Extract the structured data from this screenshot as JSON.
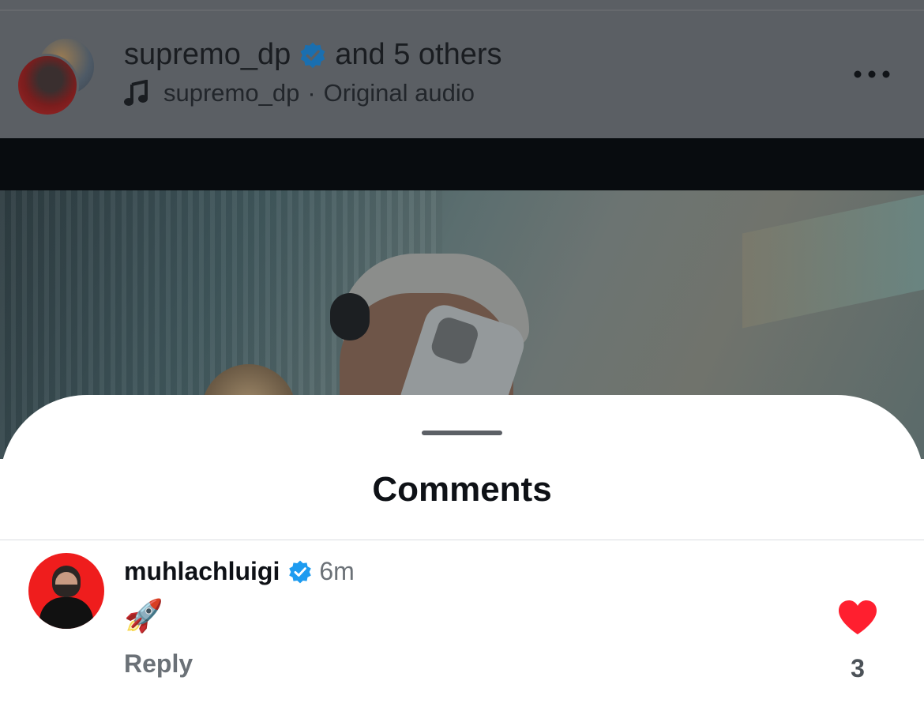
{
  "reel_header": {
    "username": "supremo_dp",
    "collaborators_text": "and 5 others",
    "audio_owner": "supremo_dp",
    "audio_separator": "·",
    "audio_name": "Original audio",
    "icons": {
      "verified": "verified-badge-icon",
      "music": "music-note-icon",
      "more": "more-options-icon"
    }
  },
  "comments_sheet": {
    "title": "Comments",
    "comments": [
      {
        "username": "muhlachluigi",
        "verified": true,
        "time": "6m",
        "text": "🚀",
        "reply_label": "Reply",
        "likes": "3",
        "liked": true
      }
    ]
  },
  "colors": {
    "verified_blue": "#1d9bf0",
    "like_red": "#ff1f2f",
    "sheet_background": "#ffffff",
    "dim_overlay": "#5b5f64"
  }
}
